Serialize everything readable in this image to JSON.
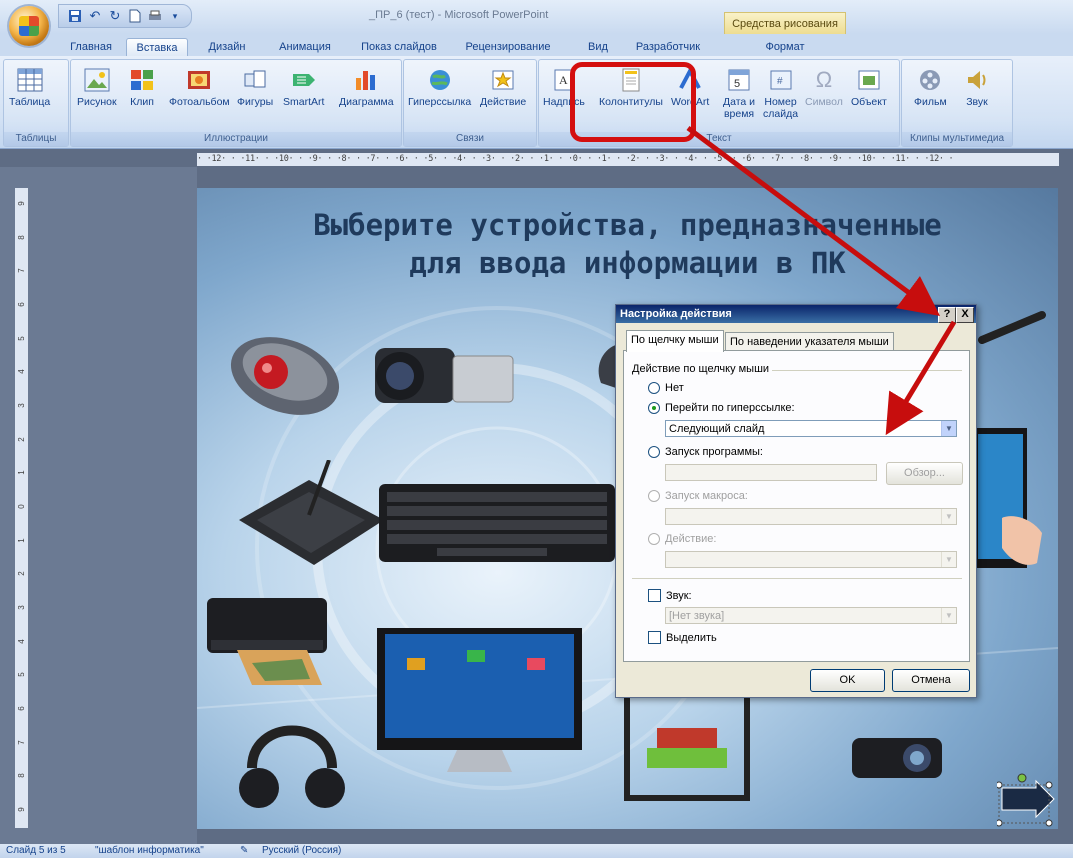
{
  "window": {
    "title": "_ПР_6 (тест) - Microsoft PowerPoint",
    "contextual_group": "Средства рисования"
  },
  "tabs": [
    {
      "label": "Главная",
      "active": false
    },
    {
      "label": "Вставка",
      "active": true
    },
    {
      "label": "Дизайн",
      "active": false
    },
    {
      "label": "Анимация",
      "active": false
    },
    {
      "label": "Показ слайдов",
      "active": false
    },
    {
      "label": "Рецензирование",
      "active": false
    },
    {
      "label": "Вид",
      "active": false
    },
    {
      "label": "Разработчик",
      "active": false
    },
    {
      "label": "Формат",
      "active": false
    }
  ],
  "ribbon": {
    "groups": {
      "tables": "Таблицы",
      "illustrations": "Иллюстрации",
      "links": "Связи",
      "text": "Текст",
      "media": "Клипы мультимедиа"
    },
    "buttons": {
      "table": "Таблица",
      "picture": "Рисунок",
      "clip": "Клип",
      "photo_album": "Фотоальбом",
      "shapes": "Фигуры",
      "smartart": "SmartArt",
      "chart": "Диаграмма",
      "hyperlink": "Гиперссылка",
      "action": "Действие",
      "textbox": "Надпись",
      "header_footer": "Колонтитулы",
      "wordart": "WordArt",
      "datetime_1": "Дата и",
      "datetime_2": "время",
      "slide_number_1": "Номер",
      "slide_number_2": "слайда",
      "symbol": "Символ",
      "object": "Объект",
      "movie": "Фильм",
      "sound": "Звук"
    }
  },
  "ruler": {
    "horizontal": "· ·12· · ·11· · ·10· · ·9· · ·8· · ·7· · ·6· · ·5· · ·4· · ·3· · ·2· · ·1· · ·0· · ·1· · ·2· · ·3· · ·4· · ·5· · ·6· · ·7· · ·8· · ·9· · ·10· · ·11· · ·12· ·",
    "vertical": [
      "9",
      "8",
      "7",
      "6",
      "5",
      "4",
      "3",
      "2",
      "1",
      "0",
      "1",
      "2",
      "3",
      "4",
      "5",
      "6",
      "7",
      "8",
      "9"
    ]
  },
  "slide": {
    "title_line1": "Выберите устройства, предназначенные",
    "title_line2": "для ввода информации в ПК"
  },
  "dialog": {
    "title": "Настройка действия",
    "help_button": "?",
    "close_button": "X",
    "tab_click": "По щелчку мыши",
    "tab_hover": "По наведении указателя мыши",
    "section_label": "Действие по щелчку мыши",
    "opt_none": "Нет",
    "opt_hyperlink": "Перейти по гиперссылке:",
    "hyperlink_value": "Следующий слайд",
    "opt_program": "Запуск программы:",
    "browse_button": "Обзор...",
    "opt_macro": "Запуск макроса:",
    "opt_action": "Действие:",
    "sound_label": "Звук:",
    "sound_value": "[Нет звука]",
    "highlight_label": "Выделить",
    "ok_button": "OK",
    "cancel_button": "Отмена"
  },
  "status": {
    "slide": "Слайд 5 из 5",
    "theme": "\"шаблон информатика\"",
    "language": "Русский (Россия)"
  },
  "colors": {
    "annotation": "#d40f0f",
    "ribbon_bg": "#d2e1f4",
    "dialog_title": "#0a246a"
  }
}
